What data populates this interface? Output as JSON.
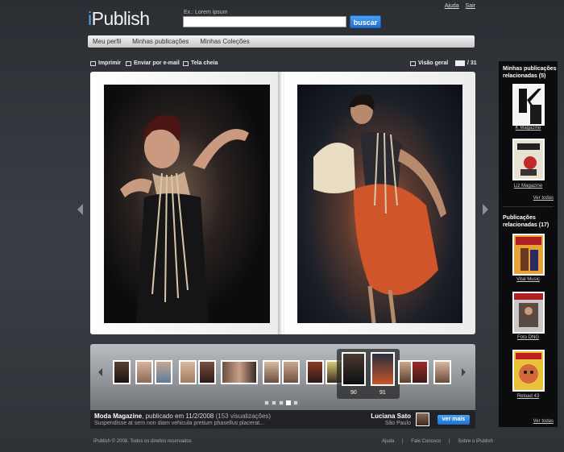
{
  "header": {
    "logo_i": "i",
    "logo_rest": "Publish",
    "search_hint": "Ex.: Lorem ipsum",
    "search_value": "",
    "search_button": "buscar",
    "links": [
      "Ajuda",
      "Sair"
    ]
  },
  "nav": {
    "items": [
      "Meu perfil",
      "Minhas publicações",
      "Minhas Coleções"
    ]
  },
  "toolbar": {
    "print": "Imprimir",
    "email": "Enviar por e-mail",
    "fullscreen": "Tela cheia",
    "overview": "Visão geral",
    "page_current": "",
    "page_total": "/ 31"
  },
  "thumbs": {
    "selected_left": "90",
    "selected_right": "91"
  },
  "info": {
    "title": "Moda Magazine",
    "published": ", publicado em 11/2/2008",
    "views": "(153 visualizações)",
    "description": "Suspendisse at sem non diam vehicula pretium phasellus placerat...",
    "author": "Luciana Sato",
    "city": "São Paulo",
    "more_button": "ver mais"
  },
  "sidebar": {
    "my_pubs_title": "Minhas publicações relacionadas (5)",
    "my_pubs": [
      {
        "caption": "K Magazine",
        "color": "#f5f5f5"
      },
      {
        "caption": "Liz Magazine",
        "color": "#e8e0d0"
      }
    ],
    "see_all": "Ver todas",
    "related_title": "Publicações relacionadas (17)",
    "related": [
      {
        "caption": "Vital Music",
        "color": "#e9a23a"
      },
      {
        "caption": "Foto DNG",
        "color": "#c8c8c8"
      },
      {
        "caption": "Reload 43",
        "color": "#e9c13a"
      }
    ],
    "see_all_2": "Ver todas"
  },
  "footer": {
    "copyright": "iPublish © 2008. Todos os direitos reservados",
    "links": [
      "Ajuda",
      "|",
      "Fale Conosco",
      "|",
      "Sobre o iPublish"
    ]
  },
  "colors": {
    "accent": "#2f86e0",
    "background": "#35383d",
    "sidebar": "#0c0c0e"
  }
}
